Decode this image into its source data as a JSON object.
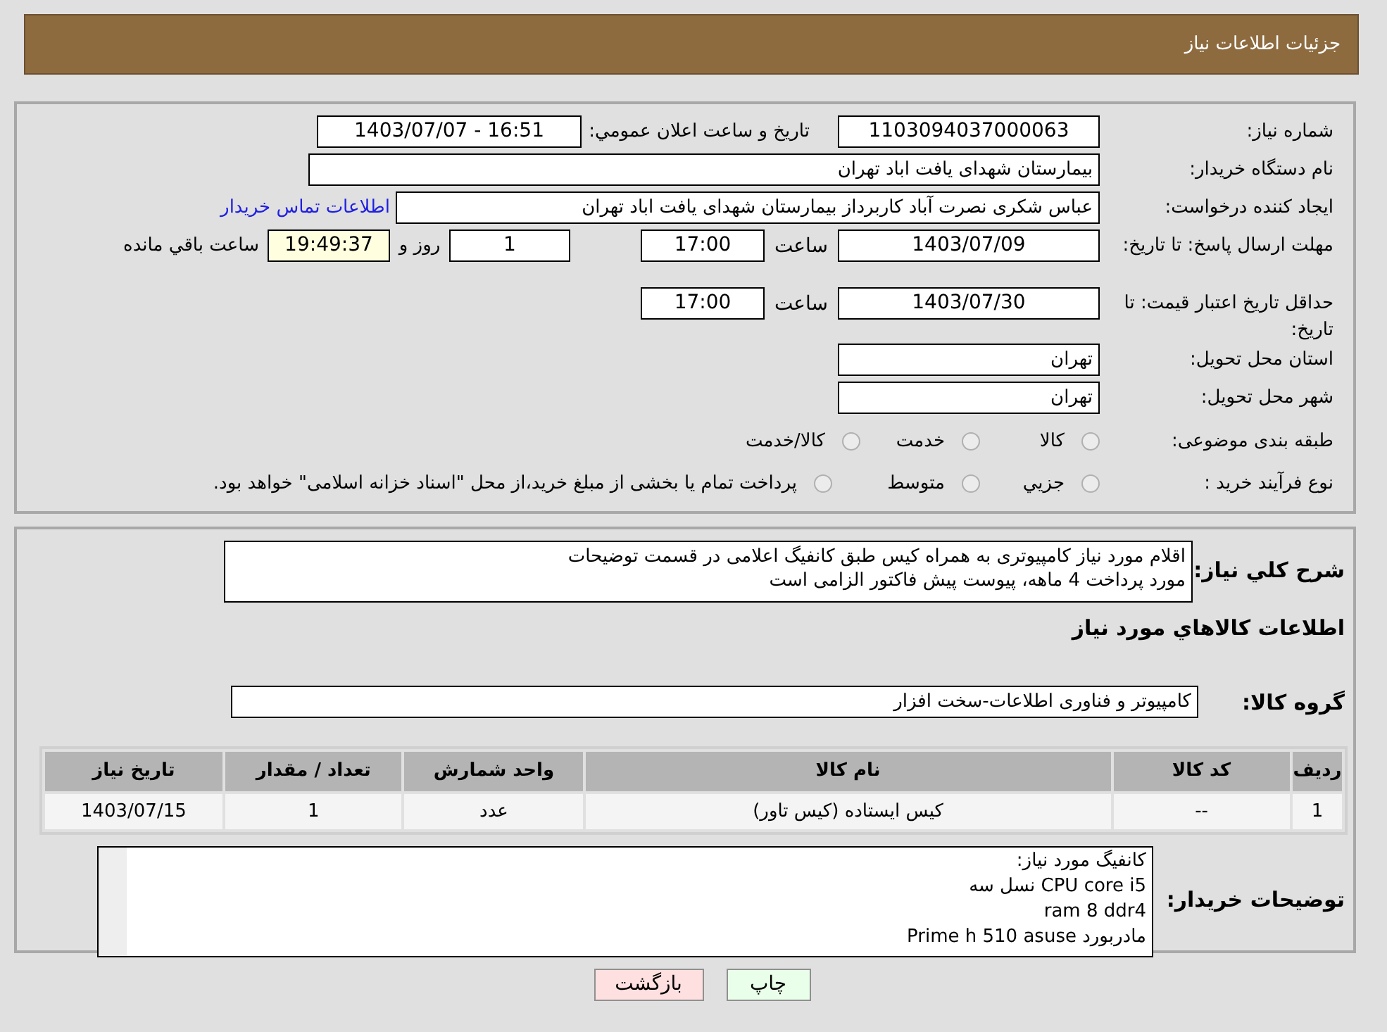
{
  "header": {
    "title": "جزئیات اطلاعات نیاز"
  },
  "info": {
    "need_number": {
      "label": "شماره نیاز:",
      "value": "1103094037000063"
    },
    "announce": {
      "label": "تاریخ و ساعت اعلان عمومي:",
      "value": "1403/07/07 - 16:51"
    },
    "buyer": {
      "label": "نام دستگاه خریدار:",
      "value": "بیمارستان شهدای یافت اباد تهران"
    },
    "creator": {
      "label": "ایجاد کننده درخواست:",
      "value": "عباس شکری نصرت آباد کاربرداز  بیمارستان شهدای یافت اباد تهران",
      "link": "اطلاعات تماس خریدار"
    },
    "deadline": {
      "label": "مهلت ارسال پاسخ: تا تاریخ:",
      "date": "1403/07/09",
      "time_label": "ساعت",
      "time": "17:00",
      "days": "1",
      "days_label": "روز و",
      "remaining": "19:49:37",
      "remaining_label": "ساعت باقي مانده"
    },
    "validity": {
      "label": "حداقل تاریخ اعتبار قیمت: تا تاریخ:",
      "date": "1403/07/30",
      "time_label": "ساعت",
      "time": "17:00"
    },
    "province": {
      "label": "استان محل تحویل:",
      "value": "تهران"
    },
    "city": {
      "label": "شهر محل تحویل:",
      "value": "تهران"
    },
    "category": {
      "label": "طبقه بندی موضوعی:",
      "options": [
        {
          "label": "كالا",
          "selected": false
        },
        {
          "label": "خدمت",
          "selected": false
        },
        {
          "label": "كالا/خدمت",
          "selected": false
        }
      ]
    },
    "purchase_type": {
      "label": "نوع فرآیند خرید :",
      "options": [
        {
          "label": "جزيي",
          "selected": false
        },
        {
          "label": "متوسط",
          "selected": false
        },
        {
          "label": "پرداخت تمام یا بخشی از مبلغ خرید،از محل \"اسناد خزانه اسلامی\" خواهد بود.",
          "selected": false
        }
      ]
    }
  },
  "details": {
    "description": {
      "label": "شرح کلي نياز:",
      "lines": [
        "اقلام مورد نیاز کامپیوتری به همراه کیس طبق کانفیگ اعلامی در قسمت توضیحات",
        "مورد پرداخت 4 ماهه، پیوست پیش فاکتور الزامی است"
      ]
    },
    "goods_heading": "اطلاعات کالاهاي مورد نياز",
    "group": {
      "label": "گروه کالا:",
      "value": "کامپیوتر و فناوری اطلاعات-سخت افزار"
    },
    "table": {
      "columns": [
        "ردیف",
        "کد کالا",
        "نام کالا",
        "واحد شمارش",
        "تعداد / مقدار",
        "تاریخ نیاز"
      ],
      "rows": [
        [
          "1",
          "--",
          "کیس ایستاده (کیس تاور)",
          "عدد",
          "1",
          "1403/07/15"
        ]
      ]
    },
    "buyer_notes": {
      "label": "توضیحات خریدار:",
      "lines": [
        "کانفیگ مورد نیاز:",
        "CPU core i5 نسل سه",
        "ram 8 ddr4",
        "مادربورد Prime h 510 asuse"
      ]
    }
  },
  "buttons": [
    {
      "label": "چاپ",
      "kind": "print"
    },
    {
      "label": "بازگشت",
      "kind": "back"
    }
  ]
}
